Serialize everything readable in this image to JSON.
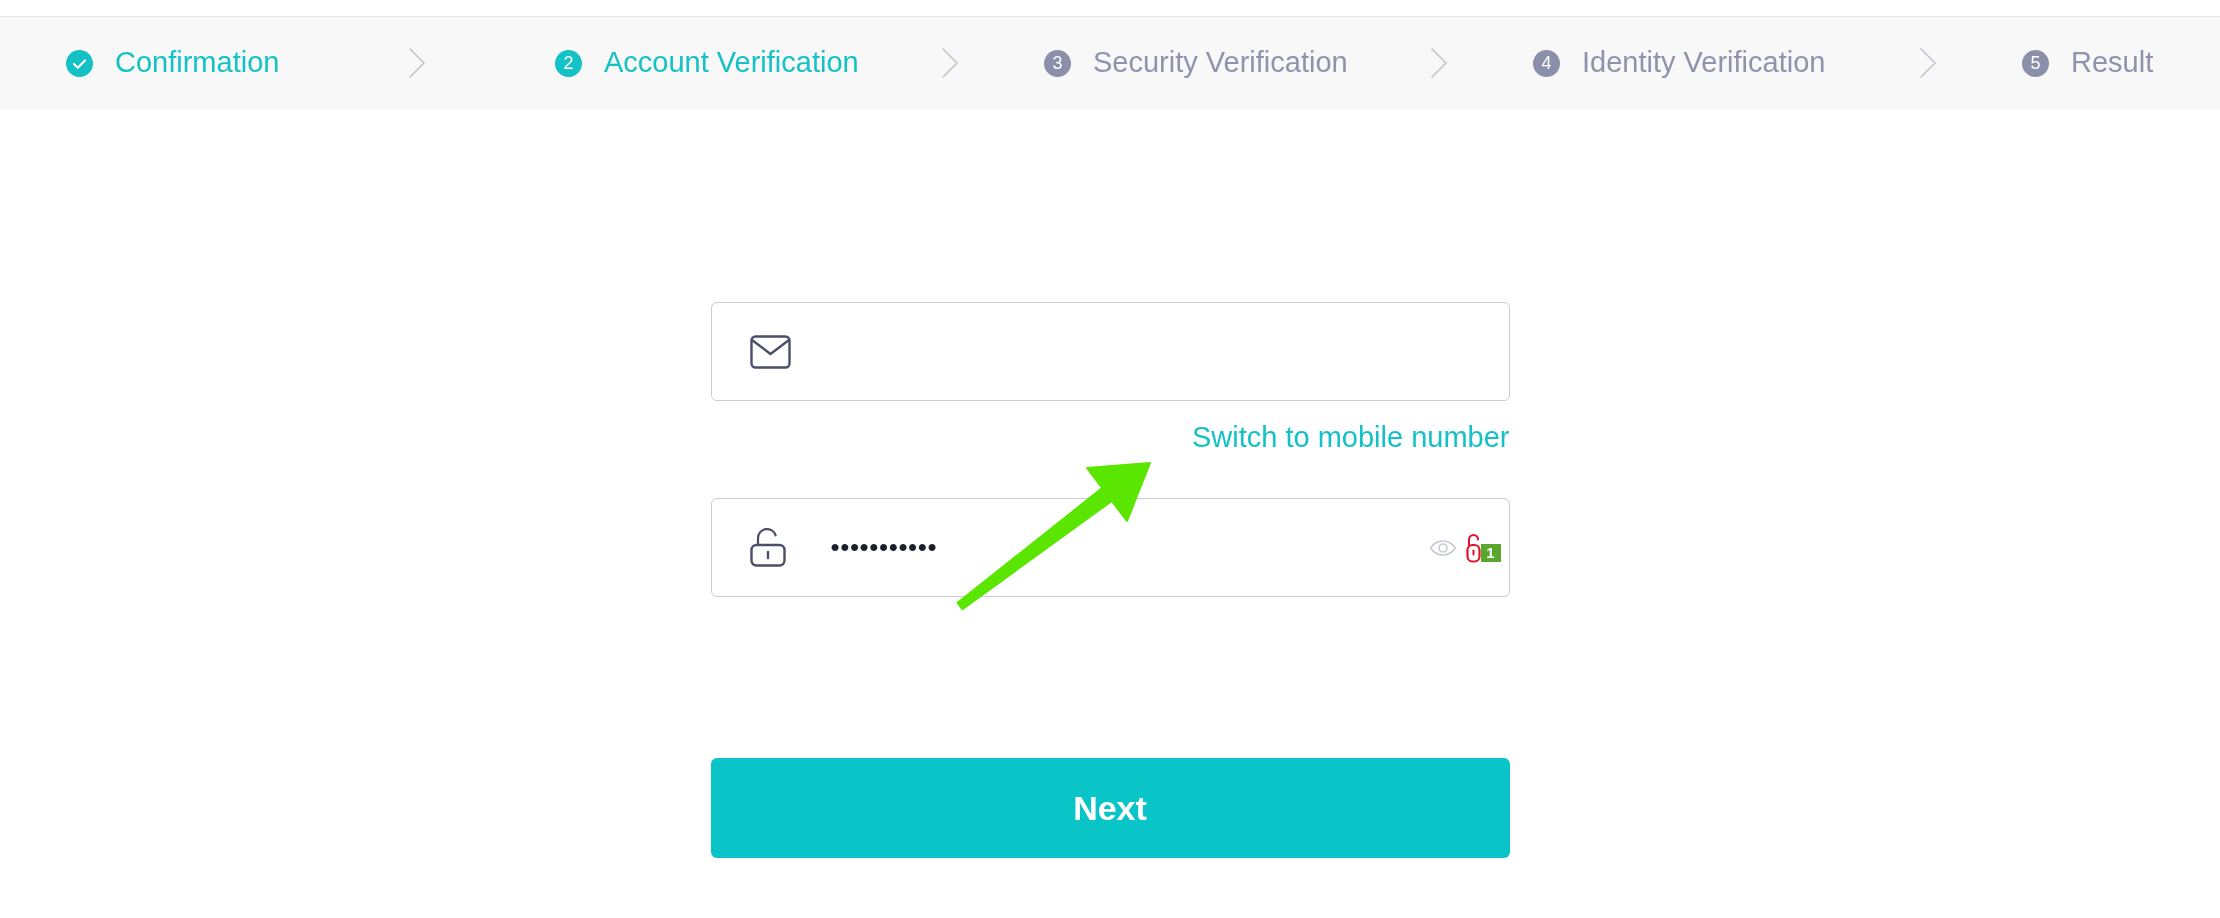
{
  "steps": [
    {
      "title": "Confirmation",
      "done": true,
      "selected": false
    },
    {
      "number": "2",
      "title": "Account Verification",
      "done": false,
      "selected": true
    },
    {
      "number": "3",
      "title": "Security Verification",
      "done": false,
      "selected": false
    },
    {
      "number": "4",
      "title": "Identity Verification",
      "done": false,
      "selected": false
    },
    {
      "number": "5",
      "title": "Result",
      "done": false,
      "selected": false
    }
  ],
  "fields": [
    {
      "kind": "email",
      "link": "Switch to mobile number"
    },
    {
      "kind": "password",
      "value": "•••••••••••",
      "badge": "1"
    }
  ],
  "button": "Next"
}
